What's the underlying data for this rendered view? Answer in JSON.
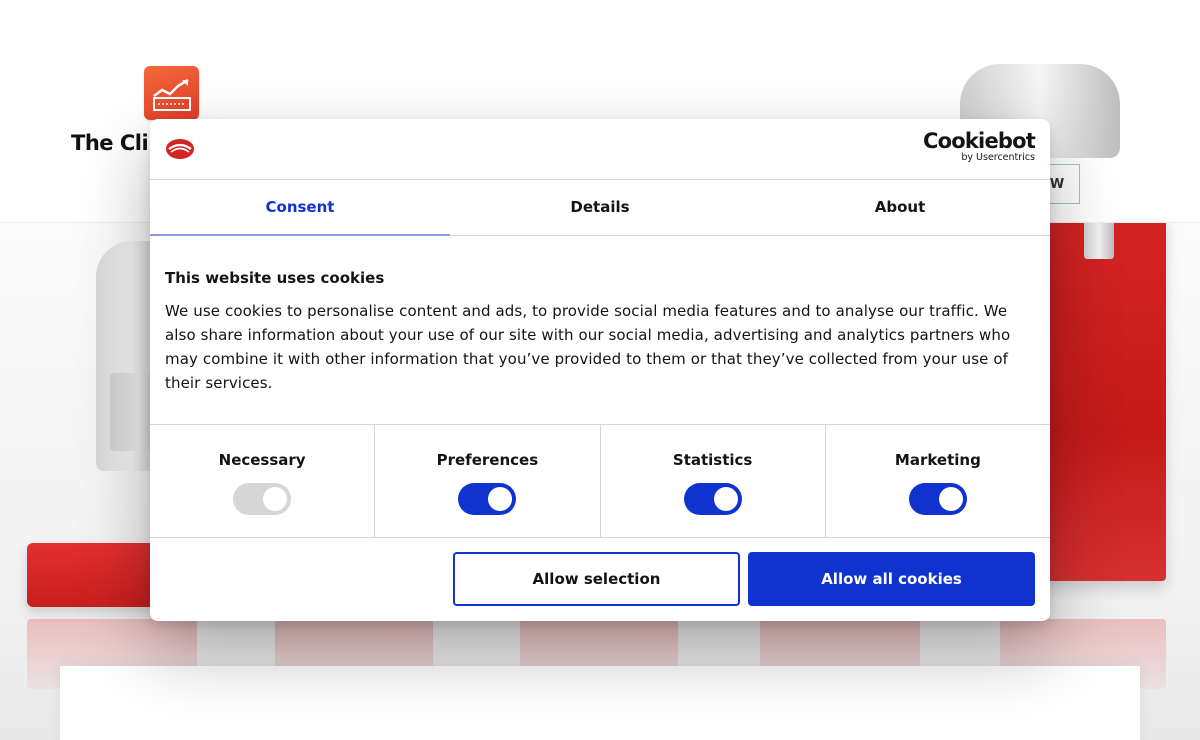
{
  "site": {
    "logo_text": "The Cli",
    "nav_cta_fragment": "W"
  },
  "dialog": {
    "provider_logo": {
      "word": "Cookiebot",
      "by": "by Usercentrics"
    },
    "tabs": [
      {
        "label": "Consent",
        "active": true
      },
      {
        "label": "Details",
        "active": false
      },
      {
        "label": "About",
        "active": false
      }
    ],
    "title": "This website uses cookies",
    "body": "We use cookies to personalise content and ads, to provide social media features and to analyse our traffic. We also share information about your use of our site with our social media, advertising and analytics partners who may combine it with other information that you’ve provided to them or that they’ve collected from your use of their services.",
    "categories": [
      {
        "label": "Necessary",
        "enabled": true,
        "locked": true
      },
      {
        "label": "Preferences",
        "enabled": true,
        "locked": false
      },
      {
        "label": "Statistics",
        "enabled": true,
        "locked": false
      },
      {
        "label": "Marketing",
        "enabled": true,
        "locked": false
      }
    ],
    "buttons": {
      "allow_selection": "Allow selection",
      "allow_all": "Allow all cookies"
    }
  },
  "colors": {
    "accent": "#1032cf",
    "brand_red": "#d42424",
    "toggle_disabled": "#d6d6d6",
    "text": "#141414"
  },
  "icons": {
    "site_logo": "factory-icon",
    "cookiebot_mark": "cookiebot-mark-icon"
  }
}
